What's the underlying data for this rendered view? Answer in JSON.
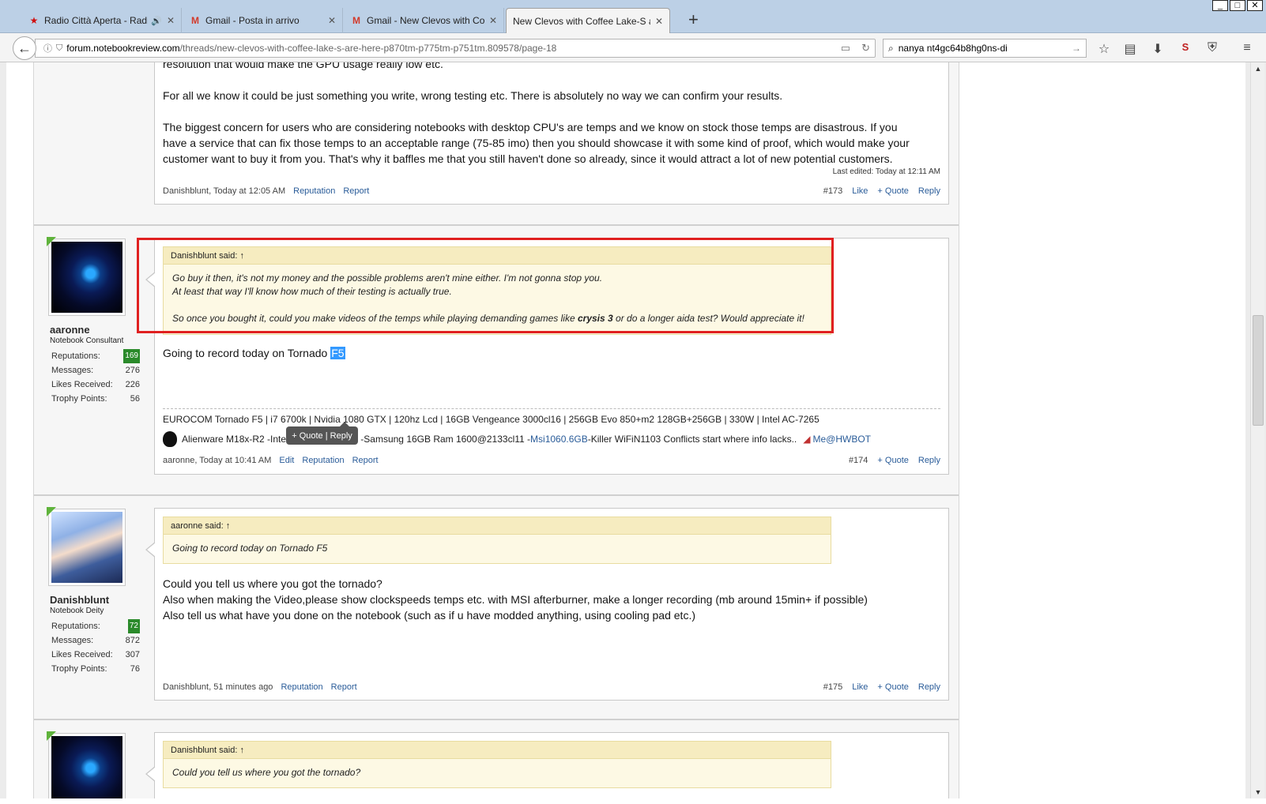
{
  "tabs": [
    {
      "title": "Radio Città Aperta - Radio",
      "icon": "star-icon"
    },
    {
      "title": "Gmail - Posta in arrivo",
      "icon": "gmail-icon"
    },
    {
      "title": "Gmail - New Clevos with Cof",
      "icon": "gmail-icon"
    },
    {
      "title": "New Clevos with Coffee Lake-S a",
      "icon": "none",
      "active": true
    }
  ],
  "nav": {
    "url_host": "forum.notebookreview.com",
    "url_path": "/threads/new-clevos-with-coffee-lake-s-are-here-p870tm-p775tm-p751tm.809578/page-18",
    "search_query": "nanya nt4gc64b8hg0ns-di"
  },
  "post173": {
    "lines": [
      "resolution that would make the GPU usage really low etc.",
      "For all we know it could be just something you write, wrong testing etc. There is absolutely no way we can confirm your results.",
      "The biggest concern for users who are considering notebooks with desktop CPU's are temps and we know on stock those temps are disastrous. If you",
      "have a service that can fix those temps to an acceptable range (75-85 imo) then you should showcase it with some kind of proof, which would make your",
      "customer want to buy it from you. That's why it baffles me that you still haven't done so already, since it would attract a lot of new potential customers."
    ],
    "last_edited": "Last edited: Today at 12:11 AM",
    "author_time": "Danishblunt, Today at 12:05 AM",
    "reputation": "Reputation",
    "report": "Report",
    "number": "#173",
    "like": "Like",
    "quote": "+ Quote",
    "reply": "Reply"
  },
  "post174": {
    "user": {
      "name": "aaronne",
      "title": "Notebook Consultant",
      "reputations_label": "Reputations:",
      "reputations": "169",
      "messages_label": "Messages:",
      "messages": "276",
      "likes_label": "Likes Received:",
      "likes": "226",
      "trophy_label": "Trophy Points:",
      "trophy": "56"
    },
    "quote_header": "Danishblunt said: ↑",
    "quote_line1": "Go buy it then, it's not my money and the possible problems aren't mine either. I'm not gonna stop you.",
    "quote_line2": "At least that way I'll know how much of their testing is actually true.",
    "quote_line3_a": "So once you bought it, could you make videos of the temps while playing demanding games like ",
    "quote_line3_b": "crysis 3",
    "quote_line3_c": " or do a longer aida test? Would appreciate it!",
    "body_a": "Going to record today on Tornado ",
    "body_sel": "F5",
    "popup": "+ Quote | Reply",
    "sig1": "EUROCOM Tornado F5 | i7 6700k | Nvidia 1080 GTX | 120hz Lcd | 16GB Vengeance 3000cl16 | 256GB Evo 850+m2 128GB+256GB | 330W | Intel AC-7265",
    "sig2_a": "Alienware M18x-R2 -Intel i7 3840qm@4.0 -Samsung 16GB Ram 1600@2133cl11 -",
    "sig2_link": "Msi1060.6GB",
    "sig2_b": " -Killer WiFiN1103 Conflicts start where info lacks..",
    "sig2_link2": "Me@HWBOT",
    "author_time": "aaronne, Today at 10:41 AM",
    "edit": "Edit",
    "reputation": "Reputation",
    "report": "Report",
    "number": "#174",
    "quote": "+ Quote",
    "reply": "Reply"
  },
  "post175": {
    "user": {
      "name": "Danishblunt",
      "title": "Notebook Deity",
      "reputations_label": "Reputations:",
      "reputations": "72",
      "messages_label": "Messages:",
      "messages": "872",
      "likes_label": "Likes Received:",
      "likes": "307",
      "trophy_label": "Trophy Points:",
      "trophy": "76"
    },
    "quote_header": "aaronne said: ↑",
    "quote_body": "Going to record today on Tornado F5",
    "line1": "Could you tell us where you got the tornado?",
    "line2": "Also when making the Video,please show clockspeeds temps etc. with MSI afterburner, make a longer recording (mb around 15min+ if possible)",
    "line3": "Also tell us what have you done on the notebook (such as if u have modded anything, using cooling pad etc.)",
    "author_time": "Danishblunt, 51 minutes ago",
    "reputation": "Reputation",
    "report": "Report",
    "number": "#175",
    "like": "Like",
    "quote": "+ Quote",
    "reply": "Reply"
  },
  "post176": {
    "quote_header": "Danishblunt said: ↑",
    "quote_body": "Could you tell us where you got the tornado?"
  }
}
